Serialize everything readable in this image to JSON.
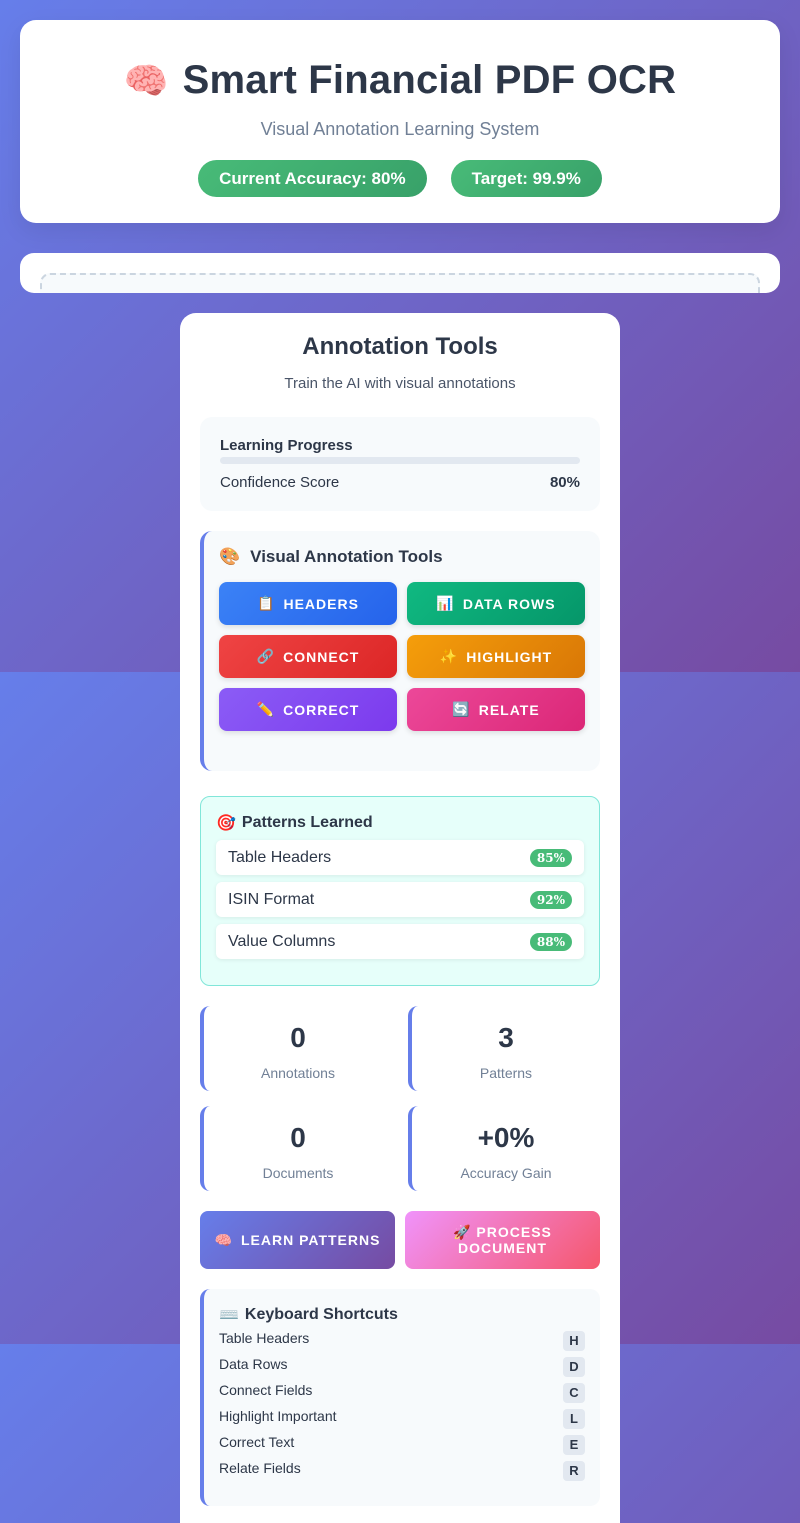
{
  "header": {
    "icon": "brain-icon",
    "icon_glyph": "🧠",
    "title": "Smart Financial PDF OCR",
    "subtitle": "Visual Annotation Learning System",
    "accuracy_badge": "Current Accuracy: 80%",
    "target_badge": "Target: 99.9%"
  },
  "panel": {
    "title": "Annotation Tools",
    "subtitle": "Train the AI with visual annotations"
  },
  "progress": {
    "title": "Learning Progress",
    "label": "Confidence Score",
    "value_text": "80%",
    "value_fraction": 0.8
  },
  "tools": {
    "icon_glyph": "🎨",
    "title": "Visual Annotation Tools",
    "buttons": [
      {
        "icon": "clipboard-icon",
        "glyph": "📋",
        "label": "HEADERS"
      },
      {
        "icon": "bar-chart-icon",
        "glyph": "📊",
        "label": "DATA ROWS"
      },
      {
        "icon": "link-icon",
        "glyph": "🔗",
        "label": "CONNECT"
      },
      {
        "icon": "sparkle-icon",
        "glyph": "✨",
        "label": "HIGHLIGHT"
      },
      {
        "icon": "pencil-icon",
        "glyph": "✏️",
        "label": "CORRECT"
      },
      {
        "icon": "refresh-icon",
        "glyph": "🔄",
        "label": "RELATE"
      }
    ]
  },
  "patterns": {
    "icon_glyph": "🎯",
    "title": "Patterns Learned",
    "items": [
      {
        "name": "Table Headers",
        "value": "85%"
      },
      {
        "name": "ISIN Format",
        "value": "92%"
      },
      {
        "name": "Value Columns",
        "value": "88%"
      }
    ]
  },
  "stats": [
    {
      "value": "0",
      "label": "Annotations"
    },
    {
      "value": "3",
      "label": "Patterns"
    },
    {
      "value": "0",
      "label": "Documents"
    },
    {
      "value": "+0%",
      "label": "Accuracy Gain"
    }
  ],
  "actions": {
    "learn": {
      "glyph": "🧠",
      "label": "LEARN PATTERNS"
    },
    "process": {
      "glyph": "🚀",
      "label": "PROCESS DOCUMENT"
    }
  },
  "shortcuts": {
    "icon_glyph": "⌨️",
    "title": "Keyboard Shortcuts",
    "items": [
      {
        "label": "Table Headers",
        "key": "H"
      },
      {
        "label": "Data Rows",
        "key": "D"
      },
      {
        "label": "Connect Fields",
        "key": "C"
      },
      {
        "label": "Highlight Important",
        "key": "L"
      },
      {
        "label": "Correct Text",
        "key": "E"
      },
      {
        "label": "Relate Fields",
        "key": "R"
      }
    ]
  },
  "colors": {
    "accent": "#667eea",
    "success": "#48bb78"
  }
}
